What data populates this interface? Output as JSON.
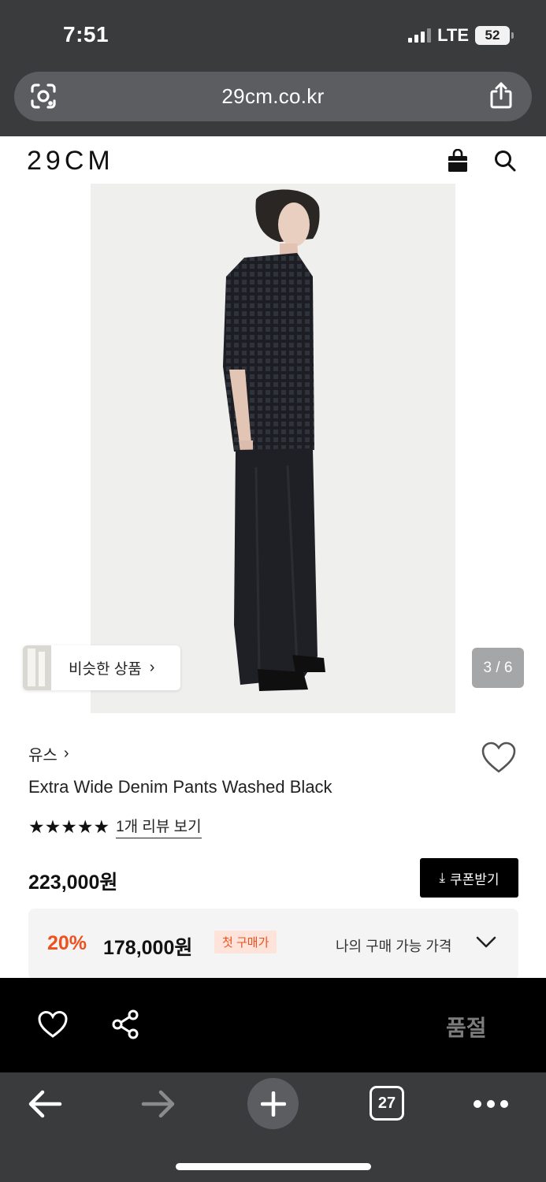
{
  "status_bar": {
    "time": "7:51",
    "network": "LTE",
    "battery_level": "52"
  },
  "browser": {
    "url": "29cm.co.kr",
    "left_icon": "lens-scan-icon",
    "right_icon": "share-icon",
    "tab_count": "27"
  },
  "header": {
    "logo": "29CM",
    "icons": [
      "shopping-bag-icon",
      "search-icon"
    ]
  },
  "gallery": {
    "similar_products_label": "비슷한 상품",
    "similar_chevron": "›",
    "page_indicator": "3 / 6"
  },
  "product": {
    "brand": "유스",
    "brand_chevron": "›",
    "name": "Extra Wide Denim Pants Washed Black",
    "rating_stars": 5,
    "stars_text": "★★★★★",
    "review_link": "1개 리뷰 보기",
    "price": "223,000원",
    "coupon_button": "쿠폰받기",
    "coupon_icon": "⤓"
  },
  "best_price": {
    "discount_percent": "20%",
    "discount_price": "178,000원",
    "badge": "첫 구매가",
    "my_price_label": "나의 구매 가능 가격"
  },
  "action_bar": {
    "soldout_label": "품절"
  },
  "colors": {
    "browser_chrome": "#3a3b3d",
    "accent_orange": "#f0501e",
    "badge_bg": "#fde3da",
    "action_bar": "#000000"
  }
}
